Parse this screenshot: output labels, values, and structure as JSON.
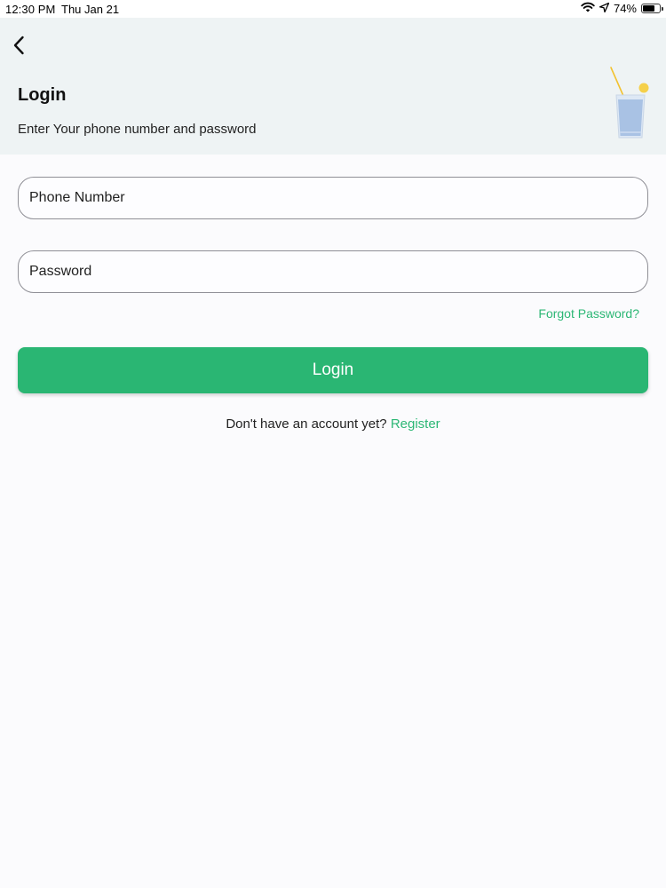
{
  "status_bar": {
    "time": "12:30 PM",
    "date": "Thu Jan 21",
    "battery_percent": "74%",
    "battery_level": 0.74,
    "icons": [
      "wifi-icon",
      "location-icon",
      "battery-icon"
    ]
  },
  "header": {
    "back_icon": "chevron-left-icon",
    "title": "Login",
    "subtitle": "Enter Your phone number and password",
    "illustration": "drink-glass-illustration"
  },
  "form": {
    "phone_placeholder": "Phone Number",
    "phone_value": "",
    "password_placeholder": "Password",
    "password_value": "",
    "forgot_password": "Forgot Password?",
    "login_label": "Login"
  },
  "footer": {
    "prompt": "Don't have an account yet?",
    "register_label": "Register"
  },
  "colors": {
    "accent": "#2ab673",
    "header_background": "#eef3f4",
    "page_background": "#fbfbfd"
  }
}
